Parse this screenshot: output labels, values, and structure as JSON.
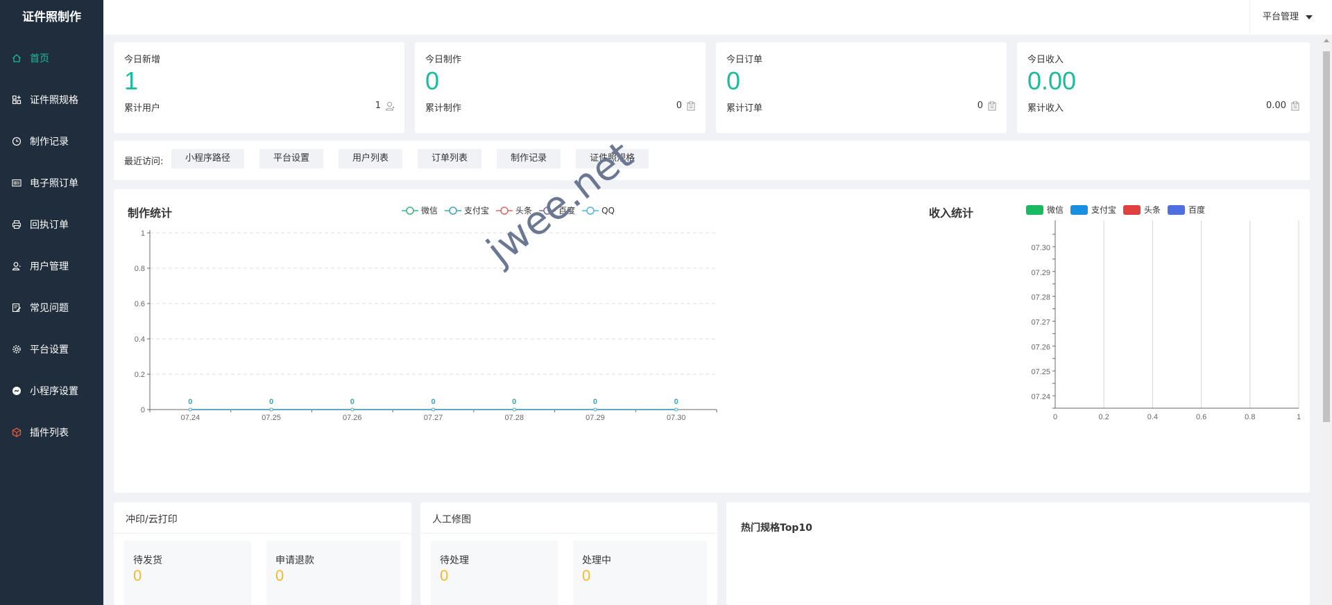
{
  "app": {
    "brand": "证件照制作"
  },
  "sidebar": {
    "items": [
      {
        "label": "首页",
        "icon": "home-icon",
        "active": true
      },
      {
        "label": "证件照规格",
        "icon": "grid-plus-icon",
        "active": false
      },
      {
        "label": "制作记录",
        "icon": "clock-icon",
        "active": false
      },
      {
        "label": "电子照订单",
        "icon": "barcode-icon",
        "active": false
      },
      {
        "label": "回执订单",
        "icon": "printer-icon",
        "active": false
      },
      {
        "label": "用户管理",
        "icon": "user-icon",
        "active": false
      },
      {
        "label": "常见问题",
        "icon": "edit-note-icon",
        "active": false
      },
      {
        "label": "平台设置",
        "icon": "gear-icon",
        "active": false
      },
      {
        "label": "小程序设置",
        "icon": "mini-program-icon",
        "active": false
      },
      {
        "label": "插件列表",
        "icon": "cube-icon",
        "active": false
      }
    ]
  },
  "topbar": {
    "platform_label": "平台管理"
  },
  "stats": [
    {
      "title": "今日新增",
      "value": "1",
      "sub": "累计用户",
      "subval": "1",
      "icon": "user-icon"
    },
    {
      "title": "今日制作",
      "value": "0",
      "sub": "累计制作",
      "subval": "0",
      "icon": "clipboard-icon"
    },
    {
      "title": "今日订单",
      "value": "0",
      "sub": "累计订单",
      "subval": "0",
      "icon": "clipboard-icon"
    },
    {
      "title": "今日收入",
      "value": "0.00",
      "sub": "累计收入",
      "subval": "0.00",
      "icon": "clipboard-icon"
    }
  ],
  "recent": {
    "label": "最近访问:",
    "tags": [
      "小程序路径",
      "平台设置",
      "用户列表",
      "订单列表",
      "制作记录",
      "证件照规格"
    ]
  },
  "production_chart": {
    "title": "制作统计",
    "legend": [
      {
        "name": "微信",
        "color": "#3cb580"
      },
      {
        "name": "支付宝",
        "color": "#3aa6b8"
      },
      {
        "name": "头条",
        "color": "#d96a6a"
      },
      {
        "name": "百度",
        "color": "#7d6ab0"
      },
      {
        "name": "QQ",
        "color": "#4fb6d8"
      }
    ]
  },
  "income_chart": {
    "title": "收入统计",
    "legend": [
      {
        "name": "微信",
        "color": "#1aba63"
      },
      {
        "name": "支付宝",
        "color": "#1a8fe0"
      },
      {
        "name": "头条",
        "color": "#e04040"
      },
      {
        "name": "百度",
        "color": "#4f6fe0"
      }
    ]
  },
  "chart_data": [
    {
      "type": "line",
      "title": "制作统计",
      "categories": [
        "07.24",
        "07.25",
        "07.26",
        "07.27",
        "07.28",
        "07.29",
        "07.30"
      ],
      "ylim": [
        0,
        1
      ],
      "yticks": [
        "0",
        "0.2",
        "0.4",
        "0.6",
        "0.8",
        "1"
      ],
      "series": [
        {
          "name": "微信",
          "values": [
            0,
            0,
            0,
            0,
            0,
            0,
            0
          ]
        },
        {
          "name": "支付宝",
          "values": [
            0,
            0,
            0,
            0,
            0,
            0,
            0
          ]
        },
        {
          "name": "头条",
          "values": [
            0,
            0,
            0,
            0,
            0,
            0,
            0
          ]
        },
        {
          "name": "百度",
          "values": [
            0,
            0,
            0,
            0,
            0,
            0,
            0
          ]
        },
        {
          "name": "QQ",
          "values": [
            0,
            0,
            0,
            0,
            0,
            0,
            0
          ]
        }
      ],
      "data_labels": [
        "0",
        "0",
        "0",
        "0",
        "0",
        "0",
        "0"
      ],
      "grid": true
    },
    {
      "type": "bar",
      "orientation": "horizontal",
      "title": "收入统计",
      "categories": [
        "07.24",
        "07.25",
        "07.26",
        "07.27",
        "07.28",
        "07.29",
        "07.30"
      ],
      "xlim": [
        0,
        1
      ],
      "xticks": [
        "0",
        "0.2",
        "0.4",
        "0.6",
        "0.8",
        "1"
      ],
      "series": [
        {
          "name": "微信",
          "values": [
            0,
            0,
            0,
            0,
            0,
            0,
            0
          ]
        },
        {
          "name": "支付宝",
          "values": [
            0,
            0,
            0,
            0,
            0,
            0,
            0
          ]
        },
        {
          "name": "头条",
          "values": [
            0,
            0,
            0,
            0,
            0,
            0,
            0
          ]
        },
        {
          "name": "百度",
          "values": [
            0,
            0,
            0,
            0,
            0,
            0,
            0
          ]
        }
      ],
      "grid": true
    }
  ],
  "watermark": "jwee.net",
  "print_panel": {
    "title": "冲印/云打印",
    "boxes": [
      {
        "label": "待发货",
        "value": "0"
      },
      {
        "label": "申请退款",
        "value": "0"
      }
    ]
  },
  "retouch_panel": {
    "title": "人工修图",
    "boxes": [
      {
        "label": "待处理",
        "value": "0"
      },
      {
        "label": "处理中",
        "value": "0"
      }
    ]
  },
  "hot_panel": {
    "title": "热门规格Top10"
  }
}
